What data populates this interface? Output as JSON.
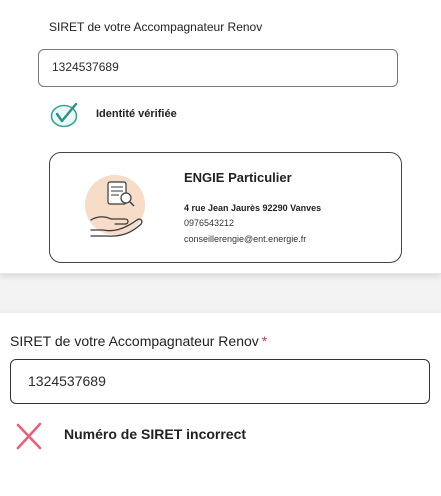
{
  "panel_valid": {
    "field_label": "SIRET de votre Accompagnateur Renov",
    "siret_value": "1324537689",
    "status_text": "Identité vérifiée",
    "status_icon": "check-circle-icon",
    "status_color": "#3aa39b",
    "accompagnateur": {
      "name": "ENGIE Particulier",
      "address": "4 rue Jean Jaurès 92290 Vanves",
      "phone": "0976543212",
      "email": "conseillerengie@ent.energie.fr",
      "illustration": "hand-holding-document-illustration"
    }
  },
  "panel_invalid": {
    "field_label": "SIRET de votre Accompagnateur Renov",
    "required_marker": "*",
    "siret_value": "1324537689",
    "error_text": "Numéro de SIRET incorrect",
    "error_icon": "cross-icon",
    "error_color": "#e8607a"
  }
}
